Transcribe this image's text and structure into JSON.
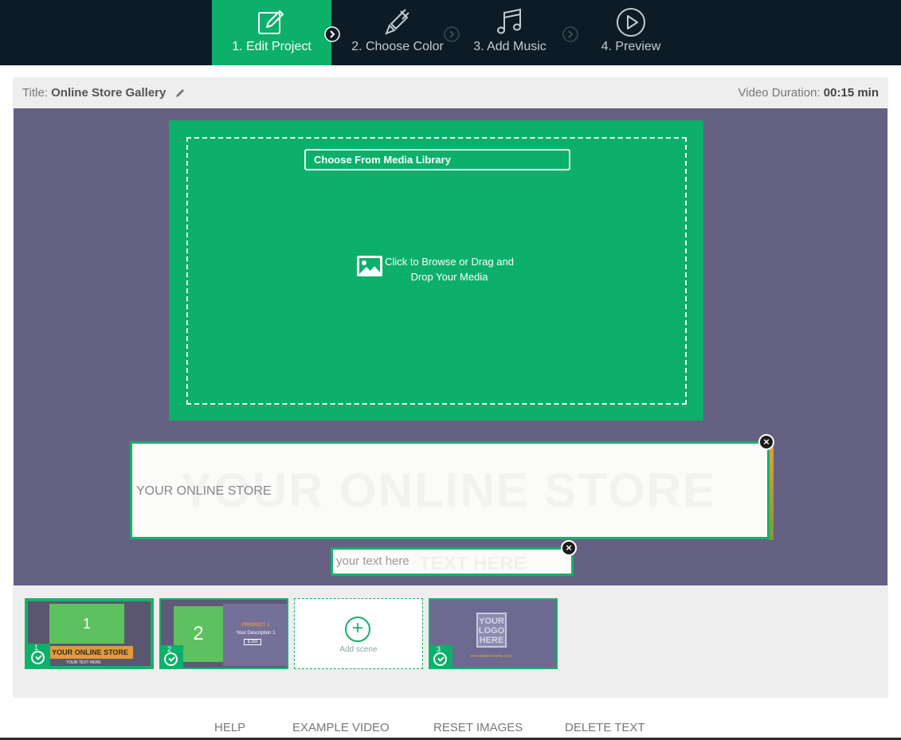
{
  "steps": [
    {
      "label": "1. Edit Project",
      "icon": "edit-icon",
      "active": true
    },
    {
      "label": "2. Choose Color",
      "icon": "brush-icon",
      "active": false
    },
    {
      "label": "3. Add Music",
      "icon": "music-icon",
      "active": false
    },
    {
      "label": "4. Preview",
      "icon": "play-icon",
      "active": false
    }
  ],
  "header": {
    "title_label": "Title:",
    "title_value": "Online Store Gallery",
    "duration_label": "Video Duration:",
    "duration_value": "00:15 min"
  },
  "media": {
    "library_button": "Choose From Media Library",
    "drop_text": "Click to Browse or Drag and Drop Your Media"
  },
  "text_fields": [
    {
      "value": "YOUR ONLINE STORE",
      "ghost": "YOUR ONLINE STORE"
    },
    {
      "value": "your text here",
      "ghost": "TEXT HERE"
    }
  ],
  "scenes": [
    {
      "number": "1",
      "block_text": "1",
      "banner": "YOUR ONLINE STORE",
      "subtext": "YOUR TEXT HERE"
    },
    {
      "number": "2",
      "block_text": "2",
      "product": "PRODUCT 1",
      "description": "Your Description 1",
      "price": "$.100"
    },
    {
      "add_label": "Add scene"
    },
    {
      "number": "3",
      "logo": "YOUR LOGO HERE",
      "url": "www.websitename.com"
    }
  ],
  "footer_links": [
    "HELP",
    "EXAMPLE VIDEO",
    "RESET IMAGES",
    "DELETE TEXT"
  ],
  "colors": {
    "accent": "#0cb06a",
    "topbar": "#0c1b25",
    "stage": "#656182"
  }
}
